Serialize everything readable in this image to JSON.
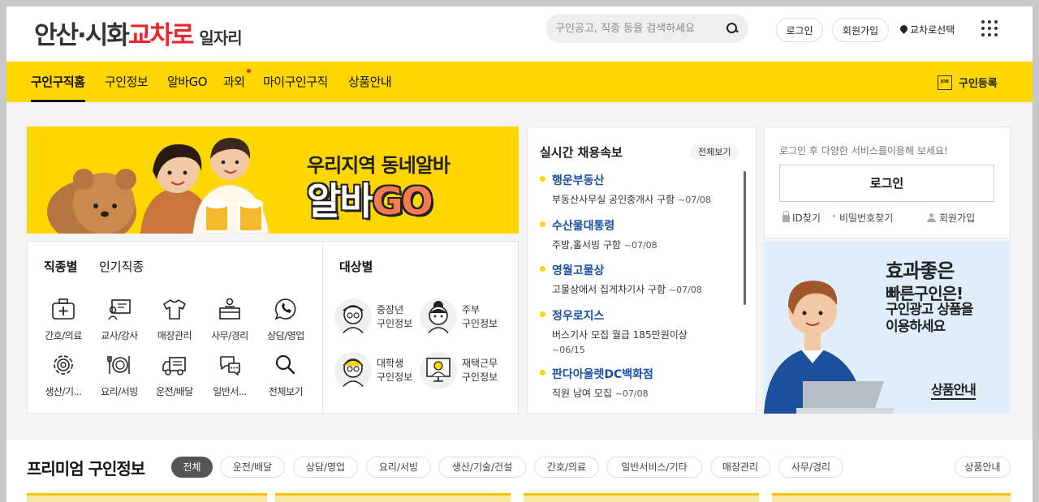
{
  "header": {
    "logo_part1": "안산·시화",
    "logo_part2": "교차로",
    "logo_part3": "일자리",
    "search_placeholder": "구인공고, 직종 등을 검색하세요",
    "login": "로그인",
    "signup": "회원가입",
    "region": "교차로선택"
  },
  "nav": {
    "items": [
      "구인구직홈",
      "구인정보",
      "알바GO",
      "과외",
      "마이구인구직",
      "상품안내"
    ],
    "job_register": "구인등록",
    "job_icon_text": "JOB"
  },
  "banner": {
    "line1": "우리지역 동네알바",
    "line2a": "알바",
    "line2b": "GO"
  },
  "categories": {
    "tabs": [
      "직종별",
      "인기직종"
    ],
    "items": [
      {
        "label": "간호/의료",
        "icon": "medical-kit-icon"
      },
      {
        "label": "교사/강사",
        "icon": "teacher-board-icon"
      },
      {
        "label": "매장관리",
        "icon": "shirt-icon"
      },
      {
        "label": "사무/경리",
        "icon": "office-desk-icon"
      },
      {
        "label": "상담/영업",
        "icon": "phone-chat-icon"
      },
      {
        "label": "생산/기...",
        "icon": "gear-icon"
      },
      {
        "label": "요리/서빙",
        "icon": "dish-icon"
      },
      {
        "label": "운전/배달",
        "icon": "truck-icon"
      },
      {
        "label": "일반서...",
        "icon": "chat-bubble-icon"
      },
      {
        "label": "전체보기",
        "icon": "search-icon"
      }
    ],
    "target_title": "대상별",
    "targets": [
      {
        "line1": "중장년",
        "line2": "구인정보"
      },
      {
        "line1": "주부",
        "line2": "구인정보"
      },
      {
        "line1": "대학생",
        "line2": "구인정보"
      },
      {
        "line1": "재택근무",
        "line2": "구인정보"
      }
    ]
  },
  "realtime": {
    "title": "실시간 채용속보",
    "more": "전체보기",
    "items": [
      {
        "company": "행운부동산",
        "desc": "부동산사무실 공인중개사 구함",
        "date": "~07/08"
      },
      {
        "company": "수산물대통령",
        "desc": "주방,홀서빙 구함",
        "date": "~07/08"
      },
      {
        "company": "영월고물상",
        "desc": "고물상에서 집게차기사 구함",
        "date": "~07/08"
      },
      {
        "company": "정우로지스",
        "desc": "버스기사 모집 월급 185만원이상",
        "date": "~06/15"
      },
      {
        "company": "판다아울렛DC백화점",
        "desc": "직원 남여 모집",
        "date": "~07/08"
      }
    ]
  },
  "login_box": {
    "message": "로그인 후 다양한 서비스를이용해 보세요!",
    "button": "로그인",
    "find_id": "ID찾기",
    "find_pw": "비밀번호찾기",
    "signup": "회원가입"
  },
  "ad": {
    "headline1": "효과좋은",
    "headline2": "빠른구인은!",
    "sub1": "구인광고 상품을",
    "sub2": "이용하세요",
    "cta": "상품안내"
  },
  "premium": {
    "title": "프리미엄 구인정보",
    "chips": [
      "전체",
      "운전/배달",
      "상담/영업",
      "요리/서빙",
      "생산/기술/건설",
      "간호/의료",
      "일반서비스/기타",
      "매장관리",
      "사무/경리"
    ],
    "product_info": "상품안내"
  },
  "colors": {
    "brand_yellow": "#fed700",
    "logo_red": "#e8262c",
    "company_blue": "#1a4fa3"
  }
}
